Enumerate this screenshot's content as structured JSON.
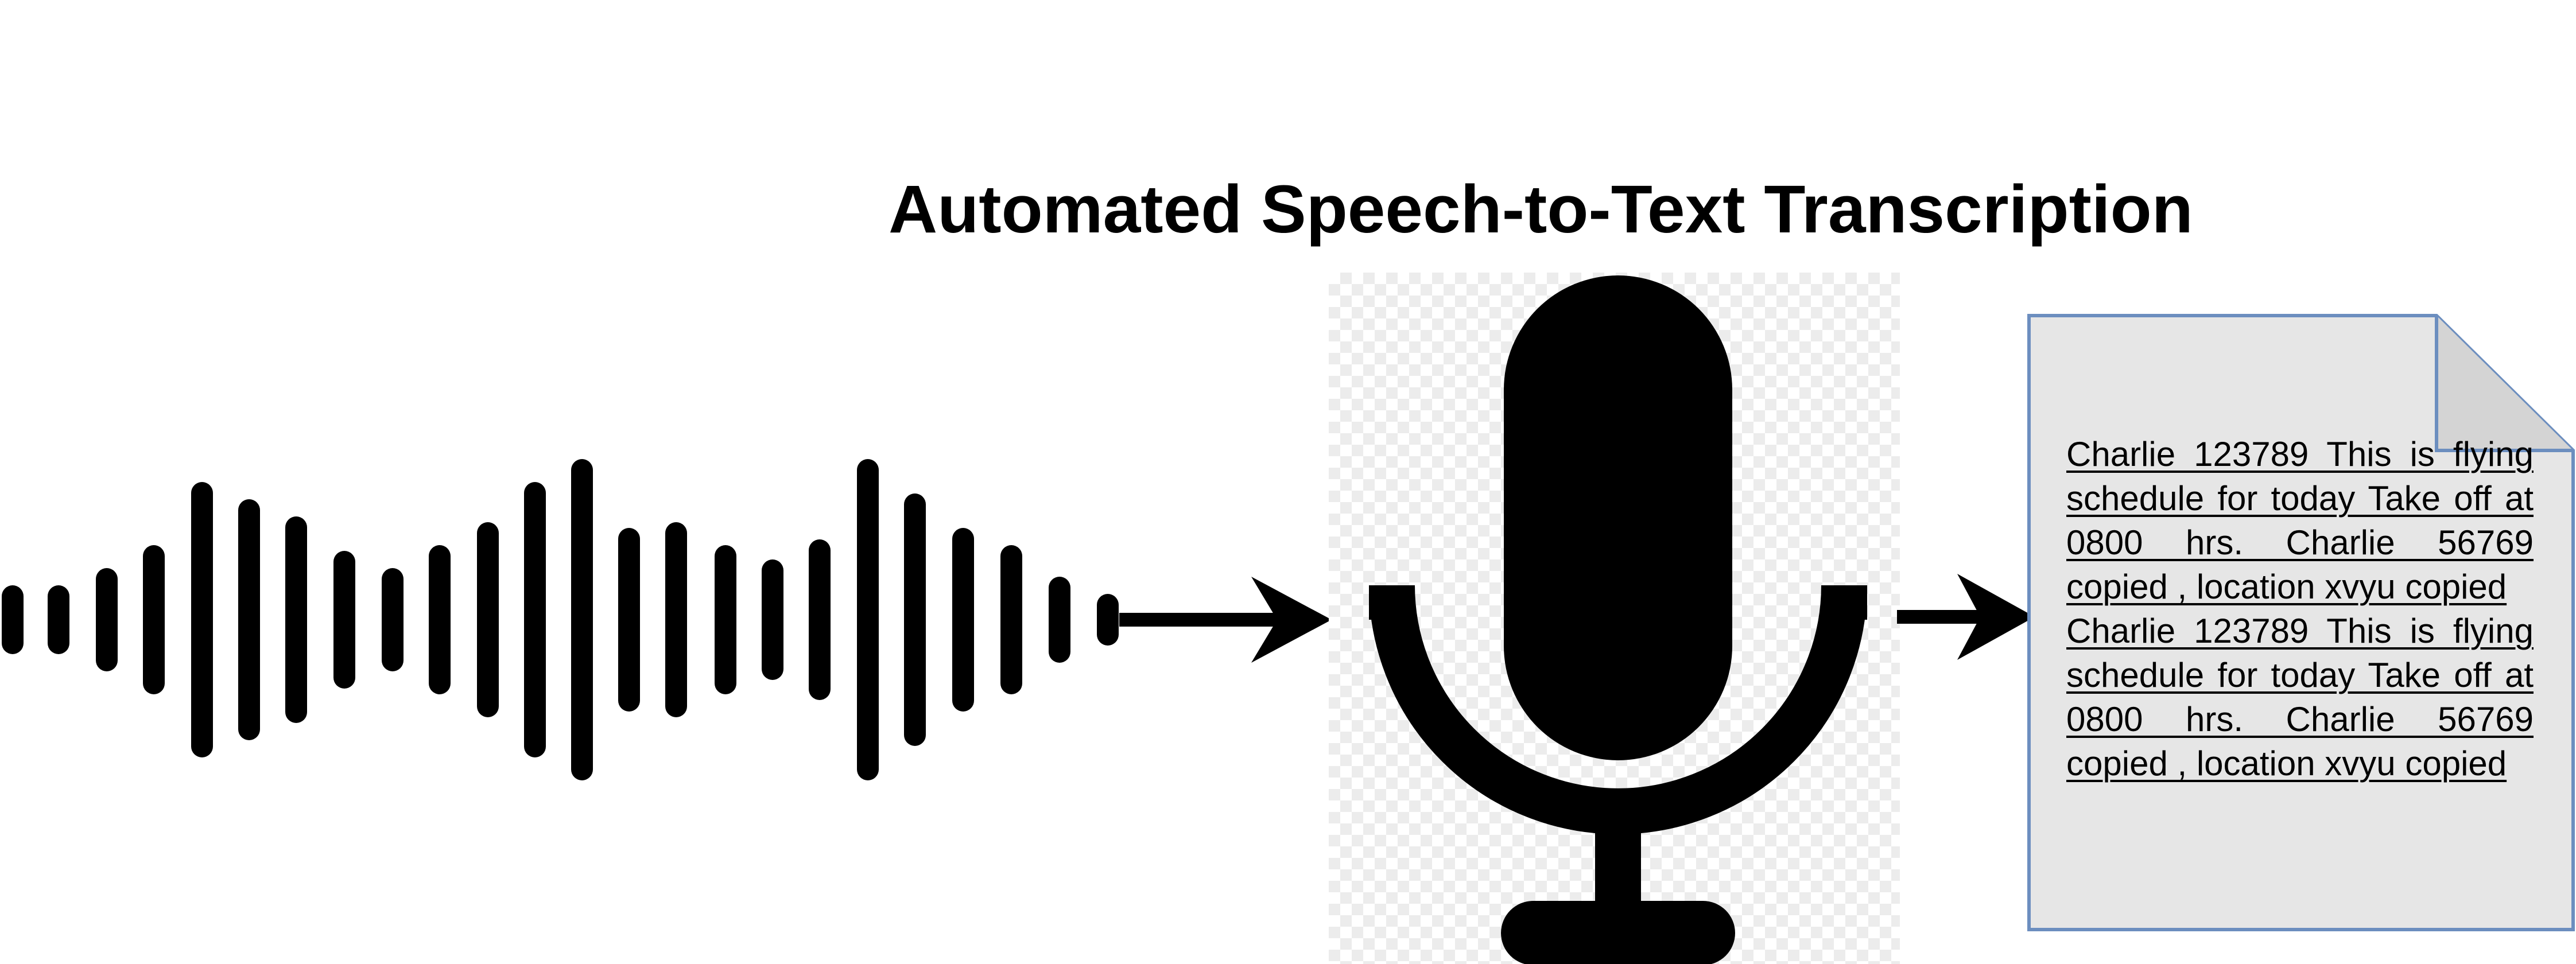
{
  "diagram": {
    "title": "Automated Speech-to-Text Transcription",
    "nodes": {
      "audio": {
        "icon": "sound-waveform-icon"
      },
      "microphone": {
        "icon": "microphone-icon"
      },
      "document": {
        "icon": "document-icon",
        "paragraphs": [
          "Charlie 123789 This is flying schedule for today Take off at 0800 hrs. Charlie 56769 copied , location xvyu copied",
          "Charlie 123789 This is flying schedule for today Take off at 0800 hrs. Charlie 56769 copied , location xvyu copied"
        ]
      }
    },
    "edges": [
      {
        "from": "audio",
        "to": "microphone",
        "icon": "arrow-right-icon"
      },
      {
        "from": "microphone",
        "to": "document",
        "icon": "arrow-right-icon"
      }
    ],
    "colors": {
      "ink": "#000000",
      "document_fill": "#e6e6e6",
      "document_border": "#6c8ebf",
      "checker": "#ececec"
    }
  }
}
